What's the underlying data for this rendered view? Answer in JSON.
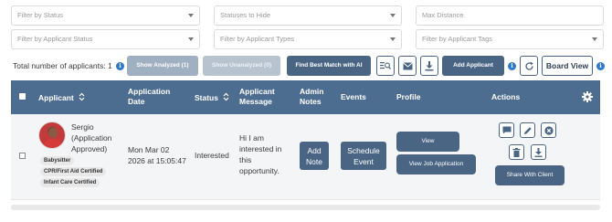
{
  "filters": {
    "status": "Filter by Status",
    "statuses_to_hide": "Statuses to Hide",
    "max_distance": "Max Distance",
    "applicant_status": "Filter by Applicant Status",
    "applicant_types": "Filter by Applicant Types",
    "applicant_tags": "Filter by Applicant Tags"
  },
  "toolbar": {
    "total_label": "Total number of applicants: 1",
    "show_analyzed": "Show Analyzed (1)",
    "show_unanalyzed": "Show Unanalyzed (0)",
    "find_best_match": "Find Best Match with AI",
    "add_applicant": "Add Applicant",
    "board_view": "Board View"
  },
  "table": {
    "headers": {
      "applicant": "Applicant",
      "application_date": "Application Date",
      "status": "Status",
      "applicant_message": "Applicant Message",
      "admin_notes": "Admin Notes",
      "events": "Events",
      "profile": "Profile",
      "actions": "Actions"
    },
    "row": {
      "name": "Sergio",
      "approval": "(Application Approved)",
      "tags": [
        "Babysitter",
        "CPR/First Aid Certified",
        "Infant Care Certified"
      ],
      "date_line1": "Mon Mar 02",
      "date_line2": "2026 at 15:05:47",
      "status": "Interested",
      "message": "Hi I am interested in this opportunity.",
      "add_note": "Add Note",
      "schedule_event": "Schedule Event",
      "view": "View",
      "view_job_application": "View Job Application",
      "share_with_client": "Share With Client"
    }
  },
  "colors": {
    "header_bg": "#4d6d90",
    "button_dark": "#4a6584",
    "info_blue": "#2f79c8"
  }
}
